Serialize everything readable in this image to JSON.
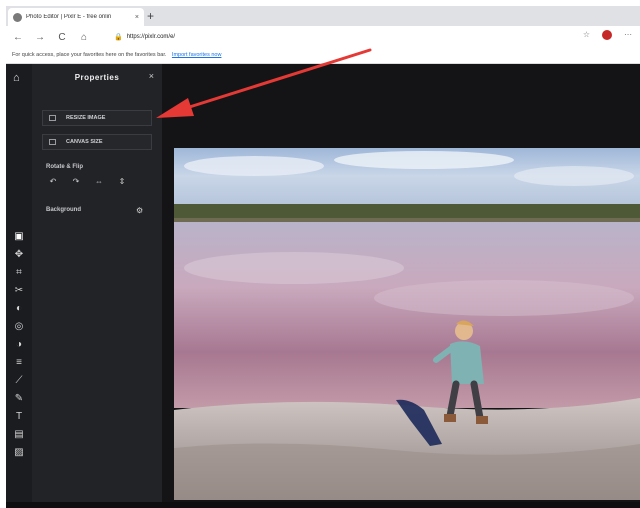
{
  "browser": {
    "tab_title": "Photo Editor | Pixlr E - free onlin",
    "tab_close": "×",
    "new_tab": "+",
    "back": "←",
    "refresh": "C",
    "home": "⌂",
    "url": "https://pixlr.com/e/",
    "favorites_text": "For quick access, place your favorites here on the favorites bar.",
    "favorites_link": "Import favorites now"
  },
  "app": {
    "properties_title": "Properties",
    "panel_close": "×",
    "resize_image_label": "RESIZE IMAGE",
    "canvas_size_label": "CANVAS SIZE",
    "rotate_flip_label": "Rotate & Flip",
    "background_label": "Background"
  },
  "colors": {
    "annotation_arrow": "#e53935",
    "panel_bg": "#222327",
    "app_bg": "#141417"
  },
  "icons": [
    "home-icon",
    "arrange-icon",
    "move-icon",
    "crop-icon",
    "cutout-icon",
    "adjust-icon",
    "filter-icon",
    "effect-icon",
    "liquify-icon",
    "heal-icon",
    "draw-icon",
    "text-icon",
    "element-icon",
    "image-icon"
  ]
}
